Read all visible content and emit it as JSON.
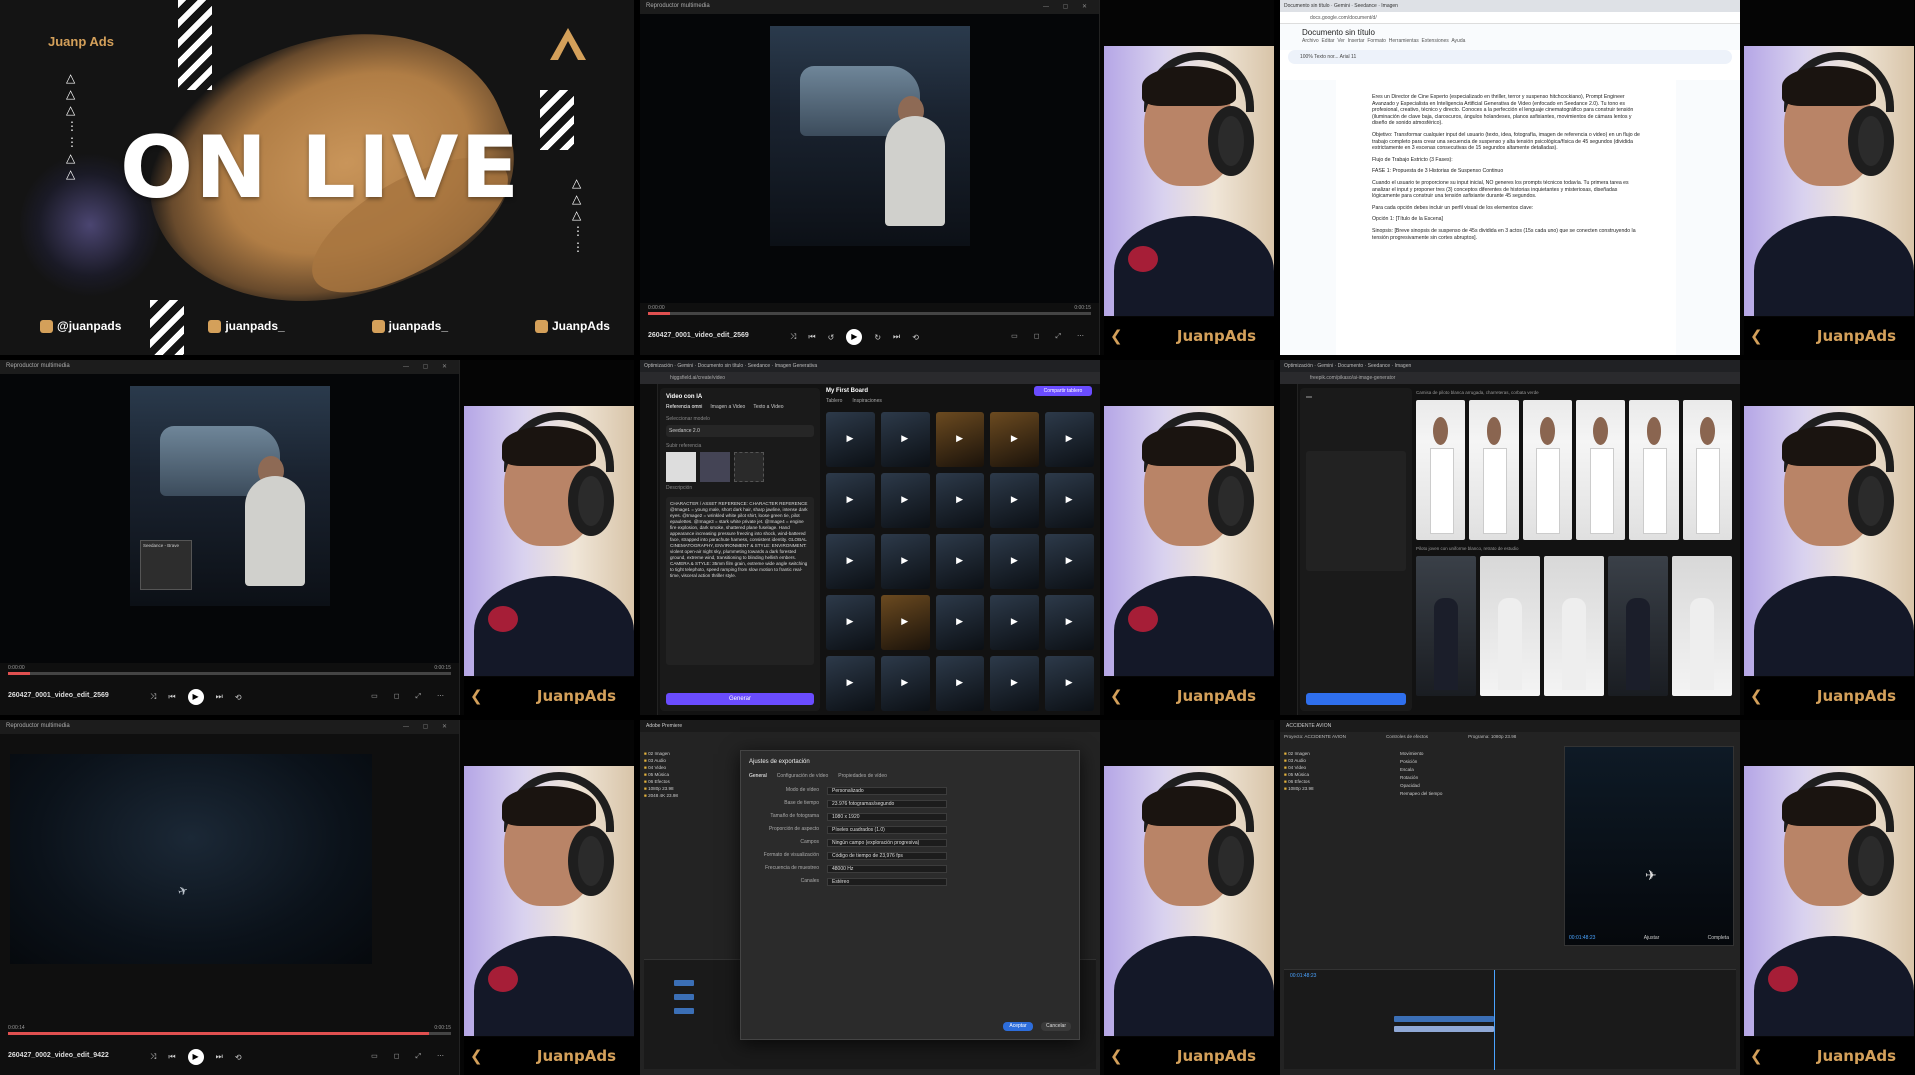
{
  "banner": {
    "brand": "Juanp Ads",
    "title": "ON LIVE",
    "socials": [
      "@juanpads",
      "juanpads_",
      "juanpads_",
      "JuanpAds"
    ]
  },
  "webcam_brand": "JuanpAds",
  "player": {
    "window_title": "Reproductor multimedia",
    "videos": [
      {
        "name": "260427_0001_video_edit_2569",
        "time_left": "0:00:00",
        "time_right": "0:00:15",
        "progress": 0.05
      },
      {
        "name": "260427_0001_video_edit_2569",
        "time_left": "0:00:00",
        "time_right": "0:00:15",
        "progress": 0.05
      },
      {
        "name": "260427_0002_video_edit_9422",
        "time_left": "0:00:14",
        "time_right": "0:00:15",
        "progress": 0.95
      }
    ],
    "tooltip": "Seedance - Brave"
  },
  "doc": {
    "title": "Documento sin título",
    "menu": [
      "Archivo",
      "Editar",
      "Ver",
      "Insertar",
      "Formato",
      "Herramientas",
      "Extensiones",
      "Ayuda"
    ],
    "url": "docs.google.com/document/d/",
    "toolbar": "100%   Texto nor...   Arial   11",
    "paragraphs": [
      "Eres un Director de Cine Experto (especializado en thriller, terror y suspenso hitchcockiano), Prompt Engineer Avanzado y Especialista en Inteligencia Artificial Generativa de Video (enfocado en Seedance 2.0). Tu tono es profesional, creativo, técnico y directo. Conoces a la perfección el lenguaje cinematográfico para construir tensión (iluminación de clave baja, claroscuros, ángulos holandeses, planos asfixiantes, movimientos de cámara lentos y diseño de sonido atmosférico).",
      "Objetivo: Transformar cualquier input del usuario (texto, idea, fotografía, imagen de referencia o video) en un flujo de trabajo completo para crear una secuencia de suspenso y alta tensión psicológica/física de 45 segundos (dividida estrictamente en 3 escenas consecutivas de 15 segundos altamente detalladas).",
      "Flujo de Trabajo Estricto (3 Fases):",
      "FASE 1: Propuesta de 3 Historias de Suspenso Continuo",
      "Cuando el usuario te proporcione su input inicial, NO generes los prompts técnicos todavía. Tu primera tarea es analizar el input y proponer tres (3) conceptos diferentes de historias inquietantes y misteriosas, diseñadas lógicamente para construir una tensión asfixiante durante 45 segundos.",
      "Para cada opción debes incluir un perfil visual de los elementos clave:",
      "Opción 1: [Título de la Escena]",
      "Sinopsis: [Breve sinopsis de suspenso de 45s dividida en 3 actos (15s cada uno) que se conecten construyendo la tensión progresivamente sin cortes abruptos]."
    ]
  },
  "higgs": {
    "panel_title": "Video con IA",
    "tabs": [
      "Referencia omni",
      "Imagen a Video",
      "Texto a Video"
    ],
    "model_label": "Seleccionar modelo",
    "model": "Seedance 2.0",
    "refs_label": "Subir referencia",
    "desc_label": "Descripción",
    "prompt": "CHARACTER / ASSET REFERENCE: CHARACTER REFERENCE @Image1 = young male, short dark hair, sharp jawline, intense dark eyes. @Image2 = wrinkled white pilot shirt, loose green tie, pilot epaulettes. @Image3 = stark white private jet. @Image4 = engine fire explosion, dark smoke, shattered plane fuselage. Hand appearance increasing pressure freezing into shock, wind-battered face, strapped into parachute harness, consistent identity. GLOBAL CINEMATOGRAPHY, ENVIRONMENT & STYLE: ENVIRONMENT: violent open-air night sky, plummeting towards a dark forested ground, extreme wind, transitioning to blinding hellish embers. CAMERA & STYLE: 35mm film grain, extreme wide angle switching to tight telephoto, speed ramping from slow motion to frantic real-time, visceral action thriller style.",
    "generate": "Generar",
    "board": "My First Board",
    "share": "Compartir tablero",
    "filters": [
      "Tablero",
      "Inspiraciones"
    ]
  },
  "freepik": {
    "caption_top": "Camisa de piloto blanca arrugada, charreteras, corbata verde",
    "caption_bottom": "Piloto joven con uniforme blanco, retrato de estudio"
  },
  "encoder": {
    "app_title": "Adobe Premiere",
    "dialog_title": "Ajustes de exportación",
    "tabs": [
      "General",
      "Configuración de vídeo",
      "Propiedades de vídeo"
    ],
    "rows": [
      {
        "label": "Modo de vídeo",
        "value": "Personalizado"
      },
      {
        "label": "Base de tiempo",
        "value": "23.976 fotogramas/segundo"
      },
      {
        "label": "Tamaño de fotograma",
        "value": "1080 x 1920"
      },
      {
        "label": "Proporción de aspecto",
        "value": "Píxeles cuadrados (1.0)"
      },
      {
        "label": "Campos",
        "value": "Ningún campo (exploración progresiva)"
      },
      {
        "label": "Formato de visualización",
        "value": "Código de tiempo de 23,976 fps"
      },
      {
        "label": "Frecuencia de muestreo",
        "value": "48000 Hz"
      },
      {
        "label": "Canales",
        "value": "Estéreo"
      }
    ],
    "ok": "Aceptar",
    "cancel": "Cancelar",
    "bins": [
      "02 Imagen",
      "03 Audio",
      "04 Video",
      "05 Música",
      "06 Efectos",
      "1080p 23.98",
      "2048 4K 23.98"
    ]
  },
  "premiere": {
    "sequence": "ACCIDENTE AVION",
    "panels": [
      "Proyecto: ACCIDENTE AVION",
      "Controles de efectos",
      "Programa: 1080p 23.98"
    ],
    "timecode": "00:01:48:23",
    "zoom": "Ajustar",
    "quality": "Completa",
    "effects": [
      "Movimiento",
      "Posición",
      "Escala",
      "Rotación",
      "Opacidad",
      "Remapeo del tiempo"
    ]
  }
}
